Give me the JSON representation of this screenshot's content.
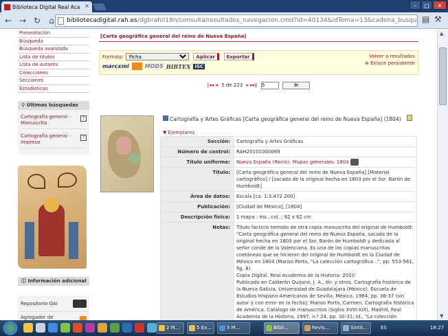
{
  "browser": {
    "tab_title": "Biblioteca Digital Real Aca",
    "tab_close": "×",
    "url_domain": "bibliotecadigital.rah.es",
    "url_path": "/dgbrah/i18n/consulta/resultados_navegacion.cmd?id=40134&idTema=13&cadena_busqueda=",
    "back_icon": "←",
    "forward_icon": "→",
    "reload_icon": "↻",
    "home_icon": "⌂",
    "win_min": "–",
    "win_max": "□",
    "win_close": "✕"
  },
  "sidebar": {
    "nav": [
      "Presentación",
      "Búsqueda",
      "Búsqueda avanzada",
      "Lista de títulos",
      "Lista de autores",
      "Colecciones",
      "Secciones",
      "Estadísticas"
    ],
    "recent_header": "Últimas búsquedas",
    "recent": [
      "Cartografía general - Manuscrita",
      "Cartografía general - Impresa"
    ],
    "help_glyph": "?",
    "info_header": "Información adicional",
    "info_items": [
      "Repositorio OAI",
      "Agregador de contenidos RSS"
    ]
  },
  "main": {
    "page_title": "[Carta geográfica general del reino de Nueva España]",
    "format_label": "Formato:",
    "format_value": "Ficha",
    "apply_button": "Aplicar",
    "export_button": "Exportar",
    "back_results": "Volver a resultados",
    "persistent_link": "Enlace persistente",
    "logos": [
      "marcxml",
      "MODS",
      "BIBTEX",
      "ISC"
    ],
    "pager": {
      "first": "|◂◂",
      "prev": "◂",
      "position": "5 de 223",
      "next": "▸",
      "last": "▸▸|",
      "input_value": "5",
      "go_button": "Ir"
    },
    "record_heading": "Cartografía y Artes Gráficas [Carta geográfica general del reino de Nueva España] (1804)",
    "copies_toggle": "▼",
    "copies_label": "Ejemplares",
    "fields": [
      {
        "key": "Sección:",
        "value": "Cartografía y Artes Gráficas"
      },
      {
        "key": "Número de control:",
        "value": "RAH20101000069"
      },
      {
        "key": "Título uniforme:",
        "value": "Nueva España (Reino). Mapas generales. 1804"
      },
      {
        "key": "Título:",
        "value": "[Carta geográfica general del reino de Nueva España] [Material cartográfico] / [sacada de la original hecha en 1803 por el Sor. Barón de Humboldt]"
      },
      {
        "key": "Área de datos:",
        "value": "Escala [ca. 1:3.472.200]"
      },
      {
        "key": "Publicación:",
        "value": "[Ciudad de México], [1804]"
      },
      {
        "key": "Descripción física:",
        "value": "1 mapa : ms., col. ; 92 x 62 cm"
      },
      {
        "key": "Notas:",
        "value": "Título facticio tomado de otra copia manuscrita del original de Humboldt: \"Carta geográfica general del reino de Nueva España, sacada de la original hecha en 1803 por el Sor. Barón de Humboldt y dedicada al señor conde de la Valenciana. Es una de las copias manuscritas coetáneas que se hicieron del original de Humboldt en la Ciudad de México en 1804 (Manso Porto, \"La colección cartográfica...\", pp. 553-561, fig. 8)\nCopia Digital. Real Academia de la Historia: 2010\nPublicado en Calderón Quijano, J. A., dir. y otros. Cartografía histórica de la Nueva Galicia, Universidad de Guadalajara (México). Escuela de Estudios Hispano-Americanos de Sevilla, México, 1984, pp. 36-37 (sin autor y con error en la fecha); Manso Porto, Carmen. Cartografía histórica de América. Catálogo de manuscritos (Siglos XVIII-XIX), Madrid, Real Academia de la Historia, 1997, n.º 24, pp. 30-31; Id., \"La colección cartográfica de Alexander von Humboldt conservada en la Real Academia de la Historia\", Boletín de la Real Academia de la Historia, t. CCV. Cuaderno III, septiembre-diciembre 2008, pp. 537-589 (ficha 1. p. 584)"
      }
    ]
  },
  "taskbar": {
    "buttons": [
      "2 M...",
      "5 Ex...",
      "5 M...",
      "Bibli...",
      "Revis...",
      "Sintit...",
      "Rec..."
    ],
    "lang": "ES",
    "clock": "18:27"
  }
}
